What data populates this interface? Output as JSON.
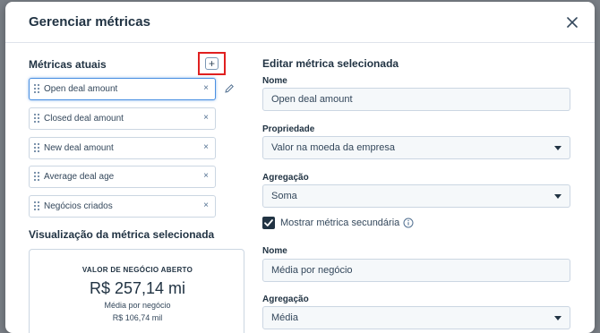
{
  "modal": {
    "title": "Gerenciar métricas"
  },
  "left": {
    "current_title": "Métricas atuais",
    "add_symbol": "+",
    "remove_symbol": "×",
    "metrics": [
      {
        "label": "Open deal amount",
        "selected": true
      },
      {
        "label": "Closed deal amount",
        "selected": false
      },
      {
        "label": "New deal amount",
        "selected": false
      },
      {
        "label": "Average deal age",
        "selected": false
      },
      {
        "label": "Negócios criados",
        "selected": false
      }
    ],
    "preview_title": "Visualização da métrica selecionada",
    "preview": {
      "title": "VALOR DE NEGÓCIO ABERTO",
      "value": "R$ 257,14 mi",
      "secondary_label": "Média por negócio",
      "secondary_value": "R$ 106,74 mil"
    }
  },
  "right": {
    "edit_title": "Editar métrica selecionada",
    "name_label": "Nome",
    "name_value": "Open deal amount",
    "property_label": "Propriedade",
    "property_value": "Valor na moeda da empresa",
    "aggregation_label": "Agregação",
    "aggregation_value": "Soma",
    "secondary_checkbox_label": "Mostrar métrica secundária",
    "secondary_checked": true,
    "secondary_name_label": "Nome",
    "secondary_name_value": "Média por negócio",
    "secondary_aggregation_label": "Agregação",
    "secondary_aggregation_value": "Média"
  },
  "colors": {
    "selected_border": "#4a90e2",
    "highlight_box": "#e02020",
    "text_dark": "#213343"
  }
}
